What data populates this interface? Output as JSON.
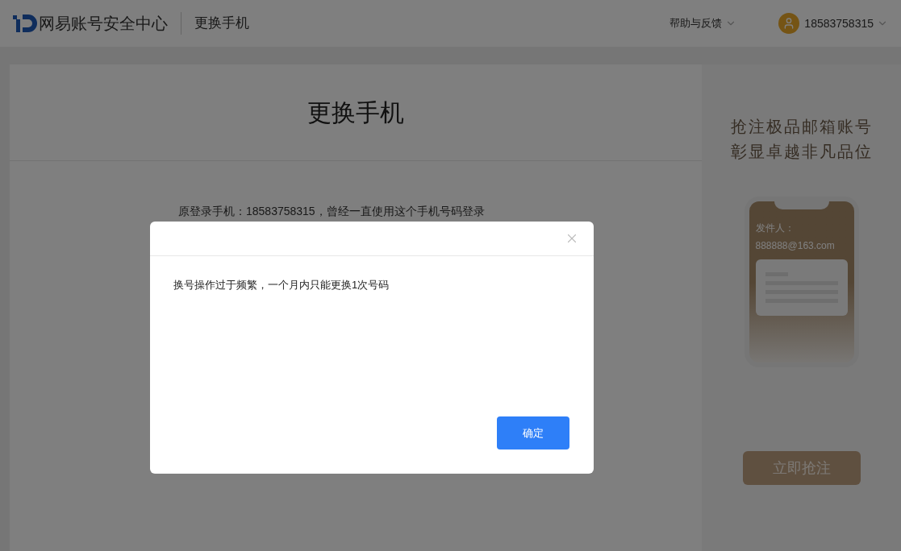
{
  "header": {
    "logo_text": "网易账号安全中心",
    "page_title": "更换手机",
    "help_menu": "帮助与反馈",
    "user": "18583758315"
  },
  "card": {
    "title": "更换手机",
    "description": "原登录手机：18583758315，曾经一直使用这个手机号码登录"
  },
  "ad": {
    "headline_lines": [
      "抢注极品邮箱账号",
      "彰显卓越非凡品位"
    ],
    "sender_label": "发件人：",
    "sender_email": "888888@163.com",
    "button": "立即抢注"
  },
  "dialog": {
    "message": "换号操作过于频繁，一个月内只能更换1次号码",
    "confirm": "确定"
  }
}
